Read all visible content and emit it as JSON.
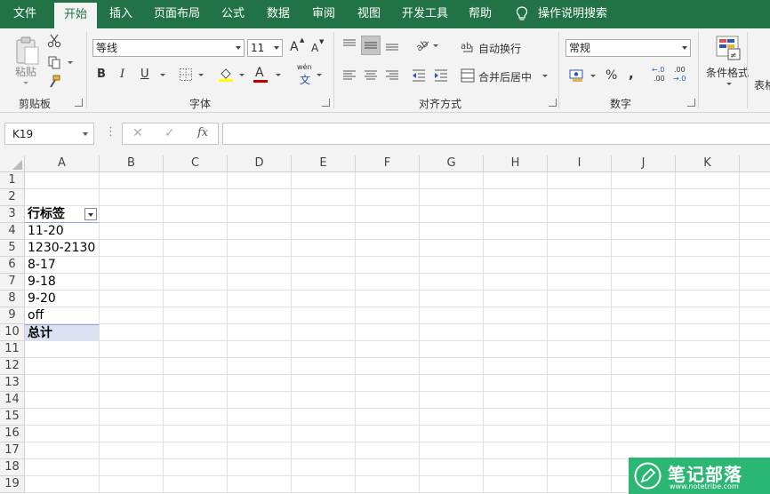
{
  "ribbon": {
    "tabs": [
      "文件",
      "开始",
      "插入",
      "页面布局",
      "公式",
      "数据",
      "审阅",
      "视图",
      "开发工具",
      "帮助"
    ],
    "active_tab": "开始",
    "tell_me": "操作说明搜索",
    "clipboard": {
      "paste": "粘贴",
      "group": "剪贴板"
    },
    "font": {
      "name": "等线",
      "size": "11",
      "group": "字体",
      "bold": "B",
      "italic": "I",
      "underline": "U",
      "grow": "A",
      "shrink": "A",
      "phonetic_top": "wén",
      "phonetic_char": "文"
    },
    "alignment": {
      "wrap": "自动换行",
      "merge": "合并后居中",
      "group": "对齐方式"
    },
    "number": {
      "format": "常规",
      "group": "数字",
      "percent": "%",
      "comma": ",",
      "inc_decimal_top": "←.0",
      "inc_decimal_bottom": ".00",
      "dec_decimal_top": ".00",
      "dec_decimal_bottom": "→.0"
    },
    "styles": {
      "conditional": "条件格式",
      "table_partial": "表格"
    }
  },
  "formula_bar": {
    "name_box": "K19",
    "fx": "fx",
    "cancel": "✕",
    "enter": "✓",
    "formula": ""
  },
  "sheet": {
    "columns": [
      "A",
      "B",
      "C",
      "D",
      "E",
      "F",
      "G",
      "H",
      "I",
      "J",
      "K"
    ],
    "rows": [
      "1",
      "2",
      "3",
      "4",
      "5",
      "6",
      "7",
      "8",
      "9",
      "10",
      "11",
      "12",
      "13",
      "14",
      "15",
      "16",
      "17",
      "18",
      "19"
    ],
    "cells": [
      {
        "ref": "A3",
        "row": 3,
        "text": "行标签",
        "bold": true,
        "filter": true
      },
      {
        "ref": "A4",
        "row": 4,
        "text": "11-20"
      },
      {
        "ref": "A5",
        "row": 5,
        "text": "1230-2130"
      },
      {
        "ref": "A6",
        "row": 6,
        "text": "8-17"
      },
      {
        "ref": "A7",
        "row": 7,
        "text": "9-18"
      },
      {
        "ref": "A8",
        "row": 8,
        "text": "9-20"
      },
      {
        "ref": "A9",
        "row": 9,
        "text": "off"
      },
      {
        "ref": "A10",
        "row": 10,
        "text": "总计",
        "bold": true,
        "total": true
      }
    ]
  },
  "watermark": {
    "title": "笔记部落",
    "url": "www.notetribe.com"
  },
  "colors": {
    "accent": "#217346",
    "pivot_total_fill": "#d9e1f2",
    "watermark": "#2bb673"
  }
}
